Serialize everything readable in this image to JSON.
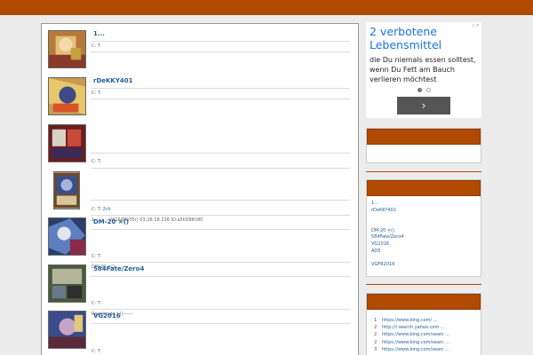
{
  "header": {
    "color": "#b04a00"
  },
  "posts": [
    {
      "title": "1...",
      "meta_prefix": "C: T:",
      "meta_link": "",
      "snippet": ""
    },
    {
      "title": "rDeKKY401",
      "meta_prefix": "C: T:",
      "meta_link": "",
      "snippet": ""
    },
    {
      "title": "",
      "meta_prefix": "C: T:",
      "meta_link": "",
      "snippet": ""
    },
    {
      "title": "",
      "meta_prefix": "C: T:",
      "meta_link": "2ch",
      "snippet_num": "1:",
      "snippet": "2016/06/05() 03:28:18.236 ID:a5kD8Kh80"
    },
    {
      "title": "DM-20 ×()",
      "meta_prefix": "C: T:",
      "meta_link": "",
      "snippet": "DM-20 ×()"
    },
    {
      "title": "584Fate/Zero4",
      "meta_prefix": "C: T:",
      "meta_link": "",
      "snippet": "Reanimate /  ()------"
    },
    {
      "title": "VG2016",
      "meta_prefix": "C: T:",
      "meta_link": "",
      "snippet": ""
    }
  ],
  "ad": {
    "headline": "2 verbotene Lebensmittel",
    "body": "die Du niemals essen solltest, wenn Du Fett am Bauch verlieren möchtest",
    "close_icon": "ad-choices-icon",
    "next_icon": "chevron-right-icon"
  },
  "sidebar": {
    "recent": [
      "1...",
      "rDeKKY401",
      "",
      "",
      "DM-20 ×()",
      "584Fate/Zero4",
      "VG2016",
      "AD5",
      "",
      "VGFR2016"
    ],
    "referrers": [
      {
        "n": "1",
        "url": "https://www.bing.com/ ..."
      },
      {
        "n": "2",
        "url": "http://r.search.yahoo.com ..."
      },
      {
        "n": "2",
        "url": "https://www.bing.com/searc ..."
      },
      {
        "n": "2",
        "url": "https://www.bing.com/searc ..."
      },
      {
        "n": "3",
        "url": "https://www.bing.com/searc ..."
      }
    ]
  }
}
